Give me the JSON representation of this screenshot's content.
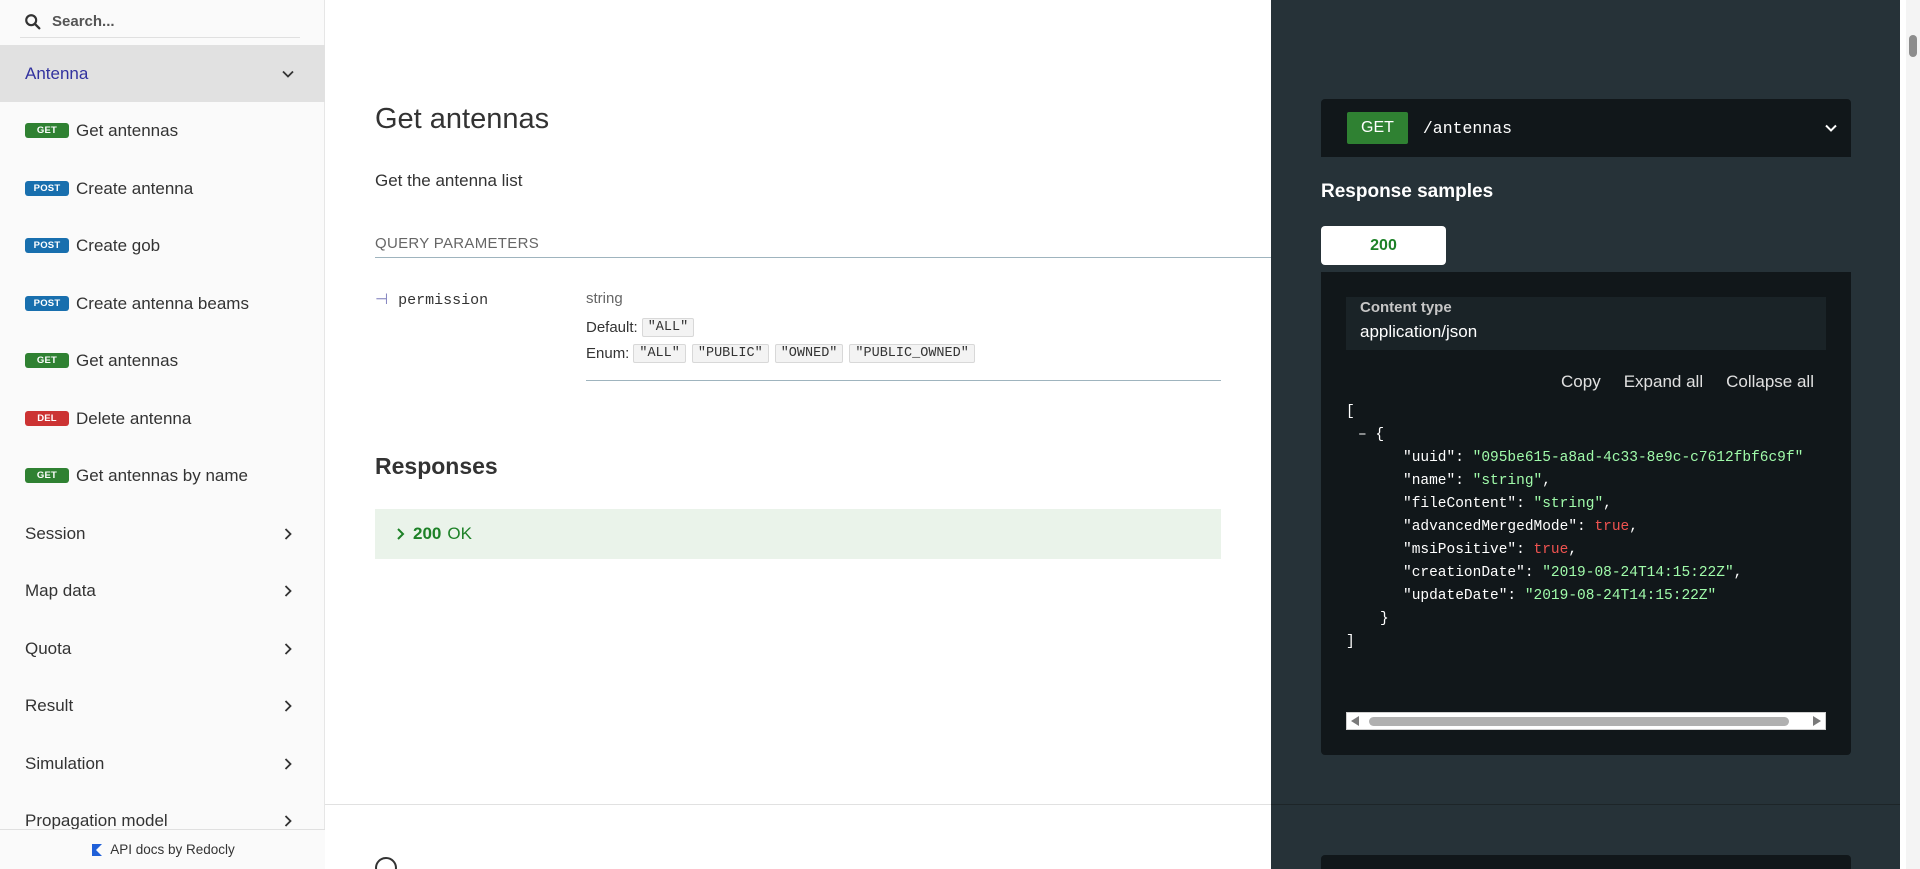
{
  "search": {
    "placeholder": "Search..."
  },
  "sidebar": {
    "groups": [
      {
        "label": "Antenna",
        "expanded": true
      },
      {
        "label": "Session"
      },
      {
        "label": "Map data"
      },
      {
        "label": "Quota"
      },
      {
        "label": "Result"
      },
      {
        "label": "Simulation"
      },
      {
        "label": "Propagation model"
      }
    ],
    "operations": [
      {
        "method": "GET",
        "label": "Get antennas"
      },
      {
        "method": "POST",
        "label": "Create antenna"
      },
      {
        "method": "POST",
        "label": "Create gob"
      },
      {
        "method": "POST",
        "label": "Create antenna beams"
      },
      {
        "method": "GET",
        "label": "Get antennas"
      },
      {
        "method": "DEL",
        "label": "Delete antenna"
      },
      {
        "method": "GET",
        "label": "Get antennas by name"
      }
    ],
    "footer": "API docs by Redocly"
  },
  "operation": {
    "title": "Get antennas",
    "description": "Get the antenna list",
    "query_params_heading": "QUERY PARAMETERS",
    "param": {
      "name": "permission",
      "type": "string",
      "default_label": "Default:",
      "default_value": "\"ALL\"",
      "enum_label": "Enum:",
      "enum_values": [
        "\"ALL\"",
        "\"PUBLIC\"",
        "\"OWNED\"",
        "\"PUBLIC_OWNED\""
      ]
    },
    "responses_heading": "Responses",
    "response": {
      "code": "200",
      "text": "OK"
    }
  },
  "right": {
    "method": "GET",
    "path": "/antennas",
    "samples_title": "Response samples",
    "tab_label": "200",
    "content_type_label": "Content type",
    "content_type_value": "application/json",
    "actions": {
      "copy": "Copy",
      "expand": "Expand all",
      "collapse": "Collapse all"
    },
    "json": {
      "open_bracket": "[",
      "collapse_marker": "– {",
      "fields": [
        {
          "key": "\"uuid\"",
          "value": "\"095be615-a8ad-4c33-8e9c-c7612fbf6c9f\"",
          "kind": "str",
          "comma": ""
        },
        {
          "key": "\"name\"",
          "value": "\"string\"",
          "kind": "str",
          "comma": ","
        },
        {
          "key": "\"fileContent\"",
          "value": "\"string\"",
          "kind": "str",
          "comma": ","
        },
        {
          "key": "\"advancedMergedMode\"",
          "value": "true",
          "kind": "bool",
          "comma": ","
        },
        {
          "key": "\"msiPositive\"",
          "value": "true",
          "kind": "bool",
          "comma": ","
        },
        {
          "key": "\"creationDate\"",
          "value": "\"2019-08-24T14:15:22Z\"",
          "kind": "str",
          "comma": ","
        },
        {
          "key": "\"updateDate\"",
          "value": "\"2019-08-24T14:15:22Z\"",
          "kind": "str",
          "comma": ""
        }
      ],
      "close_brace": "}",
      "close_bracket": "]"
    }
  },
  "colors": {
    "get": "#2f8132",
    "post": "#186fae",
    "del": "#cc3333",
    "accent": "#32329f",
    "right_bg": "#263238"
  }
}
